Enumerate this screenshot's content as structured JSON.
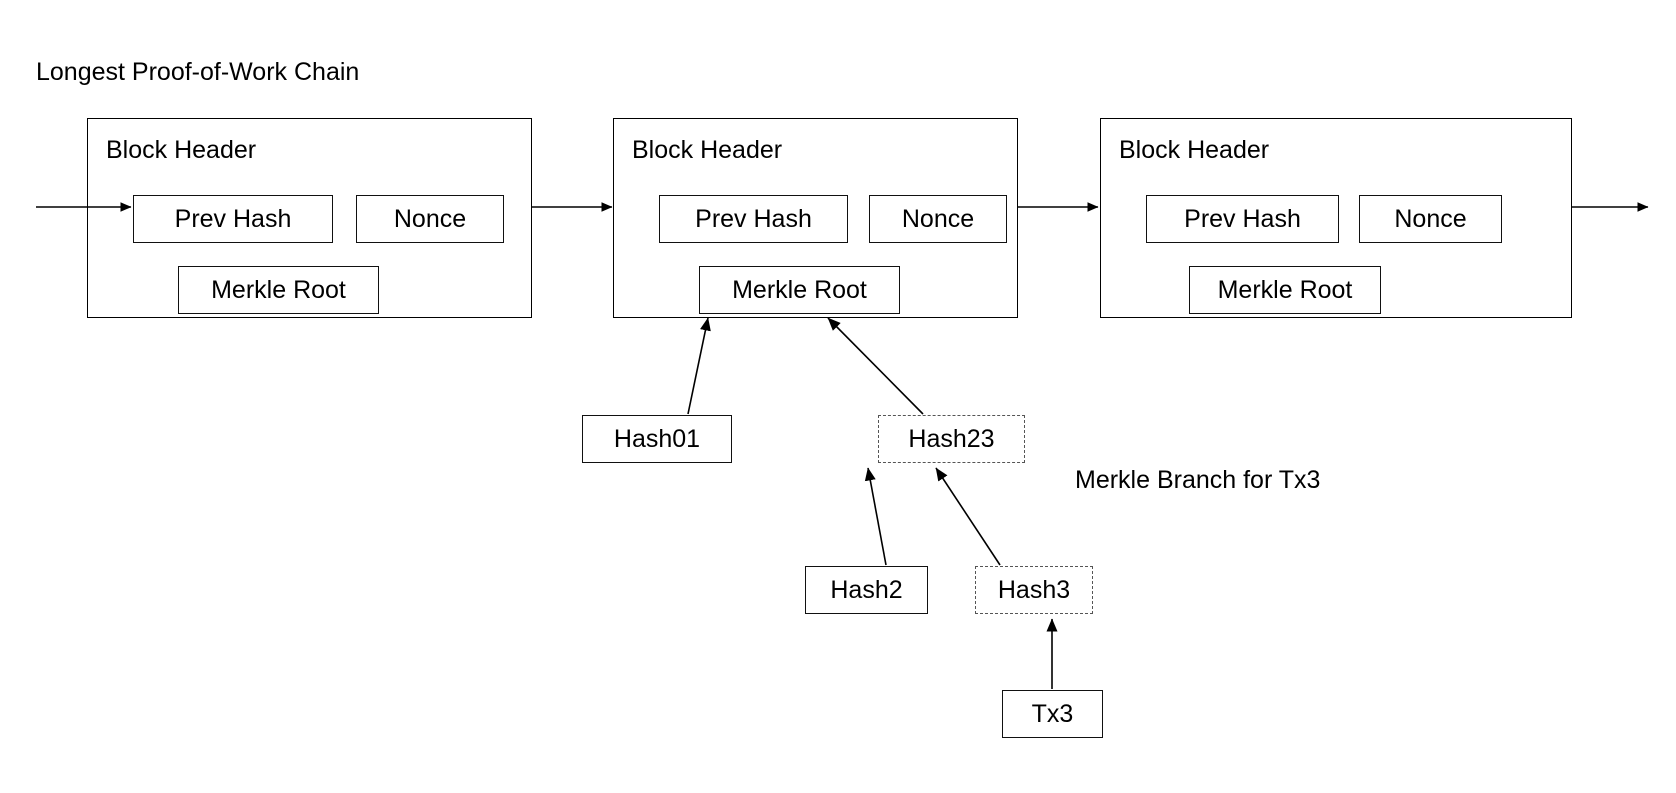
{
  "diagram": {
    "title": "Longest Proof-of-Work Chain",
    "branch_note": "Merkle Branch for Tx3",
    "colors": {
      "background": "#ffffff",
      "stroke": "#000000",
      "inner_stroke": "#111111",
      "dashed_stroke": "#555555"
    }
  },
  "blocks": [
    {
      "header_label": "Block Header",
      "prev_hash_label": "Prev Hash",
      "nonce_label": "Nonce",
      "merkle_root_label": "Merkle Root"
    },
    {
      "header_label": "Block Header",
      "prev_hash_label": "Prev Hash",
      "nonce_label": "Nonce",
      "merkle_root_label": "Merkle Root"
    },
    {
      "header_label": "Block Header",
      "prev_hash_label": "Prev Hash",
      "nonce_label": "Nonce",
      "merkle_root_label": "Merkle Root"
    }
  ],
  "merkle_tree": {
    "nodes": [
      {
        "label": "Hash01",
        "border": "solid"
      },
      {
        "label": "Hash23",
        "border": "dashed"
      },
      {
        "label": "Hash2",
        "border": "solid"
      },
      {
        "label": "Hash3",
        "border": "dashed"
      },
      {
        "label": "Tx3",
        "border": "solid"
      }
    ]
  }
}
